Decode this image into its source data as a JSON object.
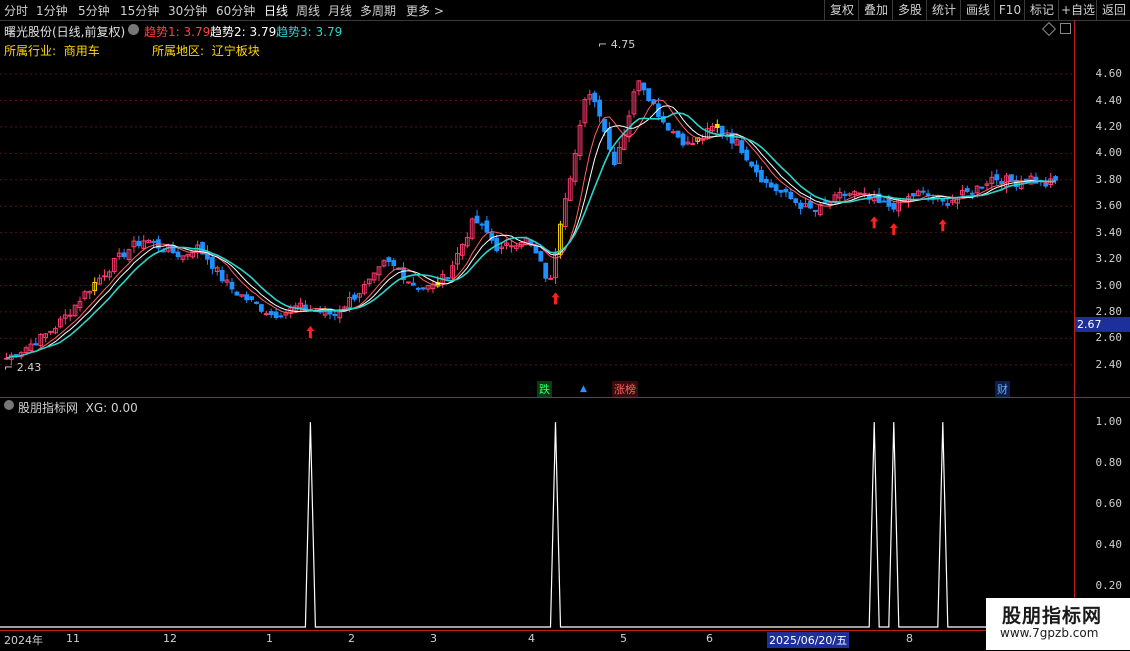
{
  "toolbar": {
    "periods": [
      "分时",
      "1分钟",
      "5分钟",
      "15分钟",
      "30分钟",
      "60分钟",
      "日线",
      "周线",
      "月线",
      "多周期",
      "更多 >"
    ],
    "active_period": "日线",
    "actions": [
      "复权",
      "叠加",
      "多股",
      "统计",
      "画线",
      "F10",
      "标记",
      "+自选",
      "返回"
    ]
  },
  "main_header": {
    "stock": "曙光股份(日线,前复权)",
    "trend1_label": "趋势1:",
    "trend1_value": "3.79",
    "trend2_label": "趋势2:",
    "trend2_value": "3.79",
    "trend3_label": "趋势3:",
    "trend3_value": "3.79",
    "industry_label": "所属行业:",
    "industry_value": "商用车",
    "region_label": "所属地区:",
    "region_value": "辽宁板块"
  },
  "price_axis": {
    "ticks": [
      "4.60",
      "4.40",
      "4.20",
      "4.00",
      "3.80",
      "3.60",
      "3.40",
      "3.20",
      "3.00",
      "2.80",
      "2.60",
      "2.40"
    ],
    "current_marker": "2.67"
  },
  "annotations": {
    "high_label": "4.75",
    "low_label": "2.43"
  },
  "events": {
    "fall": "跌",
    "limit_up": "涨榜",
    "finance": "财"
  },
  "sub_header": {
    "name": "股朋指标网",
    "xg_label": "XG:",
    "xg_value": "0.00"
  },
  "sub_axis": {
    "ticks": [
      "1.00",
      "0.80",
      "0.60",
      "0.40",
      "0.20"
    ]
  },
  "x_axis": {
    "labels": [
      "2024年",
      "11",
      "12",
      "1",
      "2",
      "3",
      "4",
      "5",
      "6",
      "2025/06/20/五",
      "8"
    ]
  },
  "watermark": {
    "title": "股朋指标网",
    "url": "www.7gpzb.com"
  },
  "colors": {
    "up": "#ff3b6e",
    "down": "#1e90ff",
    "signal_bar": "#ffd800",
    "ma1": "#ff6060",
    "ma2": "#ffffff",
    "ma3": "#2ad4c8",
    "axis": "#b82020",
    "arrow": "#ff2020"
  },
  "chart_data": [
    {
      "type": "candlestick",
      "series": [
        {
          "name": "趋势1",
          "last": 3.79
        },
        {
          "name": "趋势2",
          "last": 3.79
        },
        {
          "name": "趋势3",
          "last": 3.79
        }
      ],
      "x_labels": [
        "2024年",
        "11",
        "12",
        "1",
        "2",
        "3",
        "4",
        "5",
        "6",
        "2025/06/20/五",
        "8"
      ],
      "close_path": [
        2.45,
        2.5,
        2.56,
        2.62,
        2.7,
        2.8,
        2.92,
        3.02,
        3.12,
        3.22,
        3.3,
        3.35,
        3.3,
        3.26,
        3.22,
        3.3,
        3.2,
        3.06,
        2.96,
        2.9,
        2.84,
        2.78,
        2.8,
        2.84,
        2.82,
        2.8,
        2.78,
        2.88,
        2.96,
        3.05,
        3.18,
        3.12,
        3.02,
        2.98,
        3.0,
        3.1,
        3.3,
        3.5,
        3.4,
        3.26,
        3.32,
        3.36,
        3.22,
        3.0,
        3.6,
        4.0,
        4.5,
        4.3,
        3.92,
        4.2,
        4.58,
        4.4,
        4.24,
        4.14,
        4.06,
        4.12,
        4.2,
        4.14,
        4.06,
        3.92,
        3.78,
        3.72,
        3.66,
        3.6,
        3.56,
        3.62,
        3.68,
        3.7,
        3.66,
        3.62,
        3.6,
        3.64,
        3.7,
        3.68,
        3.62,
        3.66,
        3.7,
        3.75,
        3.82,
        3.8,
        3.78,
        3.82,
        3.76,
        3.79
      ],
      "ylim": [
        2.3,
        4.85
      ],
      "y_ticks": [
        2.4,
        2.6,
        2.8,
        3.0,
        3.2,
        3.4,
        3.6,
        3.8,
        4.0,
        4.2,
        4.4,
        4.6
      ],
      "high": 4.75,
      "low": 2.43,
      "buy_arrows_at_fraction": [
        0.29,
        0.525,
        0.825,
        0.848,
        0.893
      ]
    },
    {
      "type": "line",
      "series": [
        {
          "name": "XG",
          "values_at_fraction": [
            [
              0.29,
              1
            ],
            [
              0.525,
              1
            ],
            [
              0.825,
              1
            ],
            [
              0.848,
              1
            ],
            [
              0.893,
              1
            ]
          ]
        }
      ],
      "ylim": [
        0,
        1.05
      ],
      "y_ticks": [
        0.2,
        0.4,
        0.6,
        0.8,
        1.0
      ],
      "last": 0.0
    }
  ]
}
